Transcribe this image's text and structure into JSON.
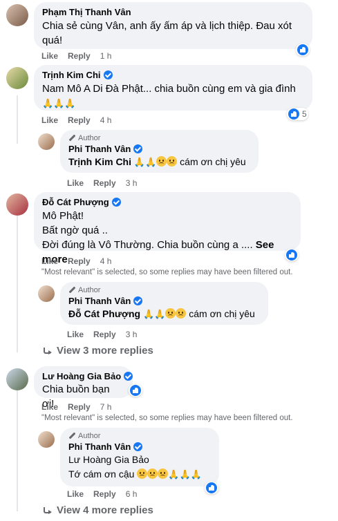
{
  "labels": {
    "like": "Like",
    "reply": "Reply",
    "author": "Author",
    "see_more": "See more"
  },
  "filter_note": "\"Most relevant\" is selected, so some replies may have been filtered out.",
  "comments": [
    {
      "name": "Phạm Thị Thanh Vân",
      "text": "Chia sẻ cùng Vân, anh ấy ấm áp và lịch thiệp. Đau xót quá!",
      "time": "1 h",
      "reactions": ""
    },
    {
      "name": "Trịnh Kim Chi",
      "text": "Nam Mô A Di Đà Phật... chia buồn cùng em và gia đình",
      "emoji": "🙏🙏🙏",
      "time": "4 h",
      "reactions": "5"
    },
    {
      "name": "Phi Thanh Vân",
      "mention": "Trịnh Kim Chi",
      "text": "cám ơn chị yêu",
      "time": "3 h"
    },
    {
      "name": "Đỗ Cát Phượng",
      "lines": [
        "Mô Phật!",
        "Bất ngờ quá ..",
        "Đời đúng là Vô Thường. Chia buồn cùng a ...."
      ],
      "time": "4 h"
    },
    {
      "name": "Phi Thanh Vân",
      "mention": "Đỗ Cát Phượng",
      "text": "cám ơn chị yêu",
      "time": "3 h"
    },
    {
      "name": "Lư Hoàng Gia Bảo",
      "text": "Chia buồn bạn ơi!",
      "time": "7 h"
    },
    {
      "name": "Phi Thanh Vân",
      "mention": "Lư Hoàng Gia Bảo",
      "text": "Tớ cám ơn cậu",
      "time": "6 h"
    }
  ],
  "view_more_1": "View 3 more replies",
  "view_more_2": "View 4 more replies",
  "colors": {
    "bubble": "#f0f2f5",
    "accent": "#1877f2",
    "muted": "#65676b"
  }
}
